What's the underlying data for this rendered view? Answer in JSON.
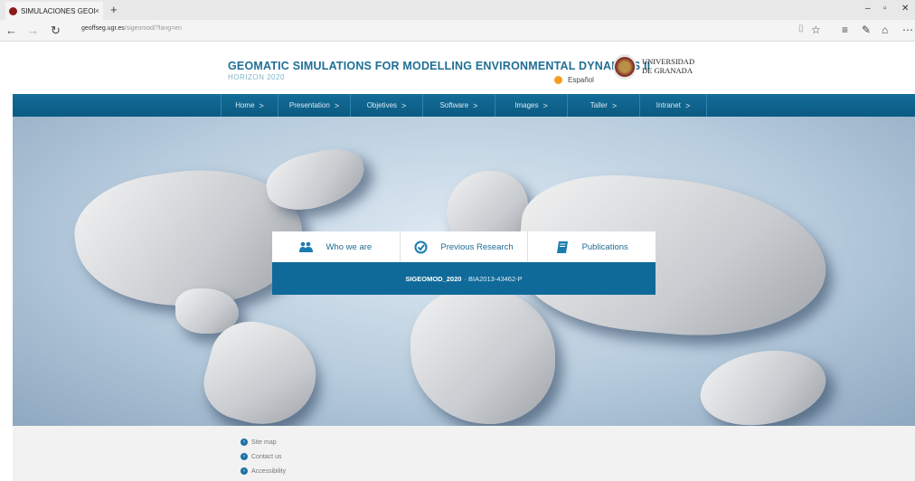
{
  "browser": {
    "tab_title": "SIMULACIONES GEOMA",
    "tab_close": "×",
    "new_tab": "+",
    "url_domain": "geoffseg.ugr.es",
    "url_path": "/sigeomod/?lang=en"
  },
  "header": {
    "title": "GEOMATIC SIMULATIONS FOR MODELLING ENVIRONMENTAL DYNAMICS II",
    "subtitle": "HORIZON 2020",
    "language": "Español",
    "university_line1": "UNIVERSIDAD",
    "university_line2": "DE GRANADA"
  },
  "nav": {
    "items": [
      {
        "label": "Home"
      },
      {
        "label": "Presentation"
      },
      {
        "label": "Objetives"
      },
      {
        "label": "Software"
      },
      {
        "label": "Images"
      },
      {
        "label": "Taller"
      },
      {
        "label": "Intranet"
      }
    ],
    "chevron": ">"
  },
  "panel": {
    "tabs": [
      {
        "label": "Who we are",
        "icon": "users-icon"
      },
      {
        "label": "Previous Research",
        "icon": "check-circle-icon"
      },
      {
        "label": "Publications",
        "icon": "book-icon"
      }
    ],
    "project_code": "SIGEOMOD_2020",
    "project_ref": "· BIA2013-43462-P"
  },
  "footer": {
    "links": [
      {
        "label": "Site map"
      },
      {
        "label": "Contact us"
      },
      {
        "label": "Accessibility"
      }
    ]
  },
  "colors": {
    "brand_blue": "#0f6a99",
    "title_blue": "#1f6f95"
  }
}
